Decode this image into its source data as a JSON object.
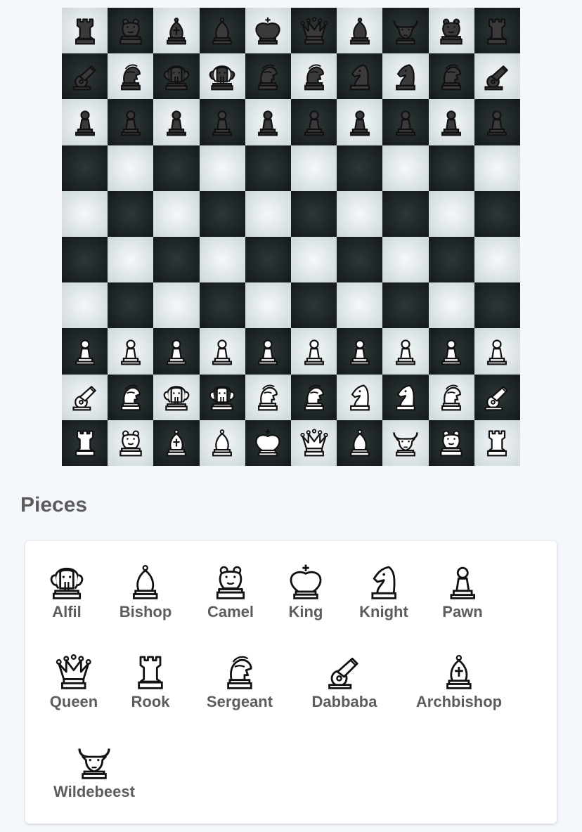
{
  "board": {
    "files": 10,
    "ranks": 10,
    "colors": {
      "light": "#dfe6e9",
      "dark": "#1c2324",
      "white_piece": "#ffffff",
      "black_piece": "#3a3a3a"
    },
    "position": [
      [
        "b-rook",
        "b-camel",
        "b-archbishop",
        "b-bishop",
        "b-king",
        "b-queen",
        "b-bishop",
        "b-wildebeest",
        "b-camel",
        "b-rook"
      ],
      [
        "b-dabbaba",
        "b-sergeant",
        "b-alfil",
        "b-alfil",
        "b-sergeant",
        "b-sergeant",
        "b-knight",
        "b-knight",
        "b-sergeant",
        "b-dabbaba"
      ],
      [
        "b-pawn",
        "b-pawn",
        "b-pawn",
        "b-pawn",
        "b-pawn",
        "b-pawn",
        "b-pawn",
        "b-pawn",
        "b-pawn",
        "b-pawn"
      ],
      [
        "",
        "",
        "",
        "",
        "",
        "",
        "",
        "",
        "",
        ""
      ],
      [
        "",
        "",
        "",
        "",
        "",
        "",
        "",
        "",
        "",
        ""
      ],
      [
        "",
        "",
        "",
        "",
        "",
        "",
        "",
        "",
        "",
        ""
      ],
      [
        "",
        "",
        "",
        "",
        "",
        "",
        "",
        "",
        "",
        ""
      ],
      [
        "w-pawn",
        "w-pawn",
        "w-pawn",
        "w-pawn",
        "w-pawn",
        "w-pawn",
        "w-pawn",
        "w-pawn",
        "w-pawn",
        "w-pawn"
      ],
      [
        "w-dabbaba",
        "w-sergeant",
        "w-alfil",
        "w-alfil",
        "w-sergeant",
        "w-sergeant",
        "w-knight",
        "w-knight",
        "w-sergeant",
        "w-dabbaba"
      ],
      [
        "w-rook",
        "w-camel",
        "w-archbishop",
        "w-bishop",
        "w-king",
        "w-queen",
        "w-bishop",
        "w-wildebeest",
        "w-camel",
        "w-rook"
      ]
    ]
  },
  "pieces_section": {
    "title": "Pieces",
    "items": [
      {
        "label": "Alfil",
        "icon": "alfil-icon"
      },
      {
        "label": "Bishop",
        "icon": "bishop-icon"
      },
      {
        "label": "Camel",
        "icon": "camel-icon"
      },
      {
        "label": "King",
        "icon": "king-icon"
      },
      {
        "label": "Knight",
        "icon": "knight-icon"
      },
      {
        "label": "Pawn",
        "icon": "pawn-icon"
      },
      {
        "label": "Queen",
        "icon": "queen-icon"
      },
      {
        "label": "Rook",
        "icon": "rook-icon"
      },
      {
        "label": "Sergeant",
        "icon": "sergeant-icon"
      },
      {
        "label": "Dabbaba",
        "icon": "dabbaba-icon"
      },
      {
        "label": "Archbishop",
        "icon": "archbishop-icon"
      },
      {
        "label": "Wildebeest",
        "icon": "wildebeest-icon"
      }
    ]
  }
}
